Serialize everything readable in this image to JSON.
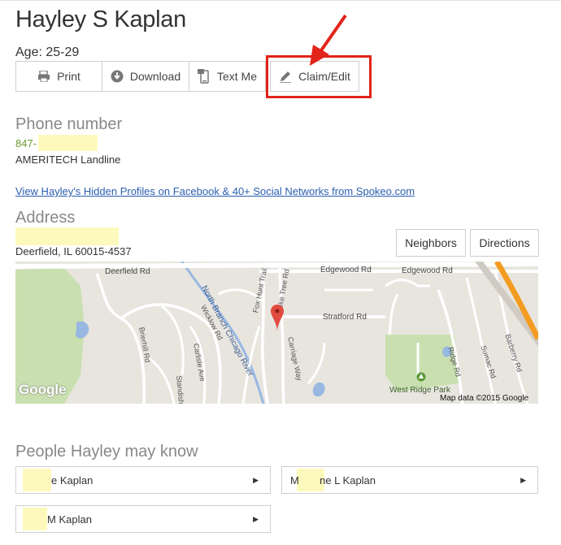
{
  "profile": {
    "name": "Hayley S Kaplan",
    "age": "Age: 25-29"
  },
  "toolbar": {
    "print": "Print",
    "download": "Download",
    "text_me": "Text Me",
    "claim_edit": "Claim/Edit"
  },
  "phone": {
    "title": "Phone number",
    "number_prefix": "847-",
    "carrier": "AMERITECH Landline"
  },
  "links": {
    "hidden_profiles": "View Hayley's Hidden Profiles on Facebook & 40+ Social Networks from Spokeo.com"
  },
  "address": {
    "title": "Address",
    "city": "Deerfield, IL 60015-4537",
    "neighbors": "Neighbors",
    "directions": "Directions"
  },
  "map": {
    "labels": {
      "deerfield_rd": "Deerfield Rd",
      "edgewood_rd_1": "Edgewood Rd",
      "edgewood_rd_2": "Edgewood Rd",
      "fox_hunt_trail": "Fox Hunt Trail",
      "smoke_tree_rd": "Smoke Tree Rd",
      "stratford_rd": "Stratford Rd",
      "river": "North Branch Chicago River",
      "wicklow_rd": "Wicklow Rd",
      "carlisle_ave": "Carlisle Ave",
      "brierhill_rd": "Brierhill Rd",
      "standish": "Standish",
      "carriage_way": "Carriage Way",
      "ridge_rd": "Ridge Rd",
      "sumac_rd": "Sumac Rd",
      "barberry_rd": "Barberry Rd",
      "west_ridge_park": "West Ridge Park",
      "google": "Google",
      "map_data": "Map data ©2015 Google"
    },
    "colors": {
      "land": "#e8e5df",
      "road": "#ffffff",
      "park": "#c9dfb0",
      "water": "#98b8e2",
      "highway": "#f39c21",
      "marker": "#e04a3f"
    }
  },
  "people": {
    "title": "People Hayley may know",
    "items": [
      {
        "label": "e Kaplan"
      },
      {
        "label": "M       ne L Kaplan"
      },
      {
        "label": "M Kaplan"
      }
    ]
  }
}
